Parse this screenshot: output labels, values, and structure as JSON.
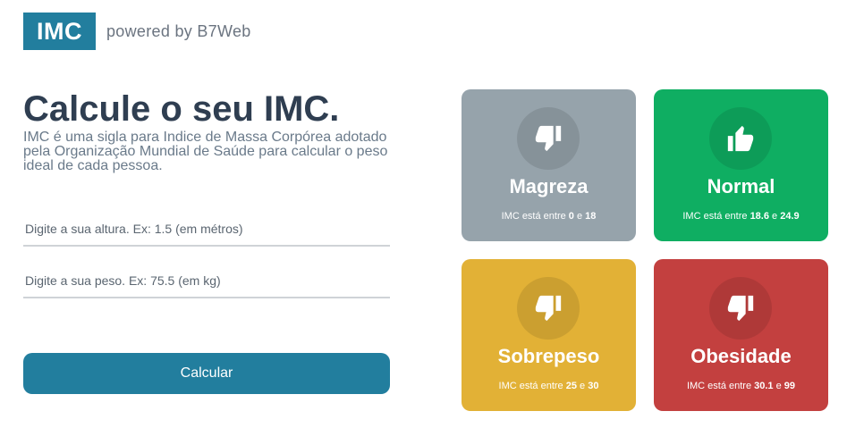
{
  "header": {
    "logo_text": "IMC",
    "powered_text": "powered by B7Web"
  },
  "main": {
    "title": "Calcule o seu IMC.",
    "description": "IMC é uma sigla para Indice de Massa Corpórea adotado pela Organização Mundial de Saúde para calcular o peso ideal de cada pessoa.",
    "height_placeholder": "Digite a sua altura. Ex: 1.5 (em métros)",
    "weight_placeholder": "Digite a sua peso. Ex: 75.5 (em kg)",
    "button_label": "Calcular"
  },
  "cards": [
    {
      "label": "Magreza",
      "prefix": "IMC está entre ",
      "min": "0",
      "conj": " e ",
      "max": "18",
      "icon": "thumbs-down-icon",
      "color": "#96a3ab"
    },
    {
      "label": "Normal",
      "prefix": "IMC está entre ",
      "min": "18.6",
      "conj": " e ",
      "max": "24.9",
      "icon": "thumbs-up-icon",
      "color": "#0fae62"
    },
    {
      "label": "Sobrepeso",
      "prefix": "IMC está entre ",
      "min": "25",
      "conj": " e ",
      "max": "30",
      "icon": "thumbs-down-icon",
      "color": "#e2b136"
    },
    {
      "label": "Obesidade",
      "prefix": "IMC está entre ",
      "min": "30.1",
      "conj": " e ",
      "max": "99",
      "icon": "thumbs-down-icon",
      "color": "#c3403f"
    }
  ]
}
